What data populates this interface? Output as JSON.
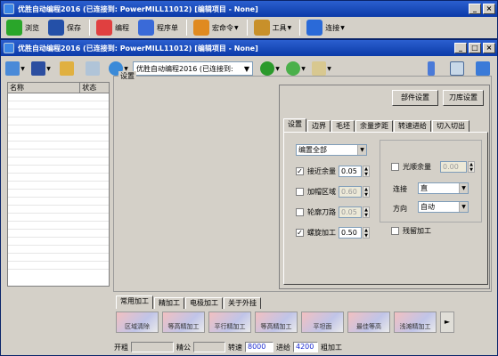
{
  "outer_window": {
    "title": "优胜自动编程2016 (已连接到: PowerMILL11012) [编辑项目 - None]",
    "toolbar": [
      {
        "label": "浏览",
        "icon": "plus-icon",
        "color": "#2aa62a"
      },
      {
        "label": "保存",
        "icon": "floppy-icon",
        "color": "#2450a8"
      },
      {
        "label": "编程",
        "icon": "colorball-icon",
        "color": "#e04040"
      },
      {
        "label": "程序单",
        "icon": "cursor-icon",
        "color": "#3a6ad8"
      },
      {
        "label": "宏命令",
        "icon": "swirl-icon",
        "color": "#e08a20"
      },
      {
        "label": "工具",
        "icon": "toolbox-icon",
        "color": "#c8902a"
      },
      {
        "label": "连接",
        "icon": "globe-icon",
        "color": "#2a6ad8"
      }
    ]
  },
  "inner_window": {
    "title": "优胜自动编程2016 (已连接到: PowerMILL11012) [编辑项目 - None]",
    "nc_label": "优胜自动编程2016 (已连接到:",
    "group_title": "设置",
    "tree_headers": [
      "名称",
      "状态"
    ],
    "buttons": {
      "part": "部件设置",
      "tool": "刀库设置"
    },
    "tabs": [
      "设置",
      "边界",
      "毛坯",
      "余量步距",
      "转速进给",
      "切入切出"
    ],
    "mode_select": "编置全部",
    "left_opts": [
      {
        "label": "接近余量",
        "checked": true,
        "value": "0.05",
        "disabled": false
      },
      {
        "label": "加帽区域",
        "checked": false,
        "value": "0.60",
        "disabled": true
      },
      {
        "label": "轮廓刀路",
        "checked": false,
        "value": "0.05",
        "disabled": true
      },
      {
        "label": "螺旋加工",
        "checked": true,
        "value": "0.50",
        "disabled": false
      }
    ],
    "right_opts": {
      "smooth": {
        "label": "光顺余量",
        "checked": false,
        "value": "0.00"
      },
      "connect": {
        "label": "连接",
        "value": "直"
      },
      "direction": {
        "label": "方向",
        "value": "自动"
      },
      "residual": {
        "label": "残留加工",
        "checked": false
      }
    },
    "bottom_tabs": [
      "常用加工",
      "精加工",
      "电极加工",
      "关于外挂"
    ],
    "strategies": [
      "区域清除",
      "等高精加工",
      "平行精加工",
      "等高精加工",
      "平坦面",
      "最佳等高",
      "浅滩精加工",
      "清角精加工"
    ],
    "status": {
      "label1": "开粗",
      "label2": "精公",
      "speed_label": "转速",
      "speed": "8000",
      "feed_label": "进给",
      "feed": "4200",
      "rough_label": "粗加工"
    }
  }
}
